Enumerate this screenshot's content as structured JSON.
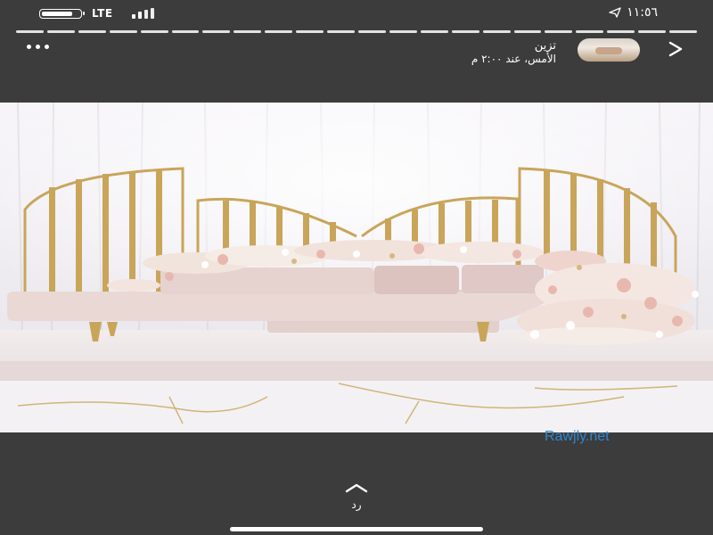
{
  "status_bar": {
    "network": "LTE",
    "time": "١١:٥٦",
    "battery_level": 0.85,
    "signal_bars": 4
  },
  "story": {
    "segments": 22,
    "user_name": "تزين",
    "post_time": "الأمس، عند ٢:٠٠ م",
    "icons": {
      "back": "chevron-left-icon",
      "more": "more-icon",
      "location": "location-arrow-icon",
      "reply": "chevron-up-icon"
    }
  },
  "watermark": "Rawjly.net",
  "reply": {
    "label": "رد"
  },
  "colors": {
    "background": "#3c3c3c",
    "watermark": "#2f86d1",
    "gold": "#c9a55a",
    "blush_pink": "#e9d2cf"
  }
}
